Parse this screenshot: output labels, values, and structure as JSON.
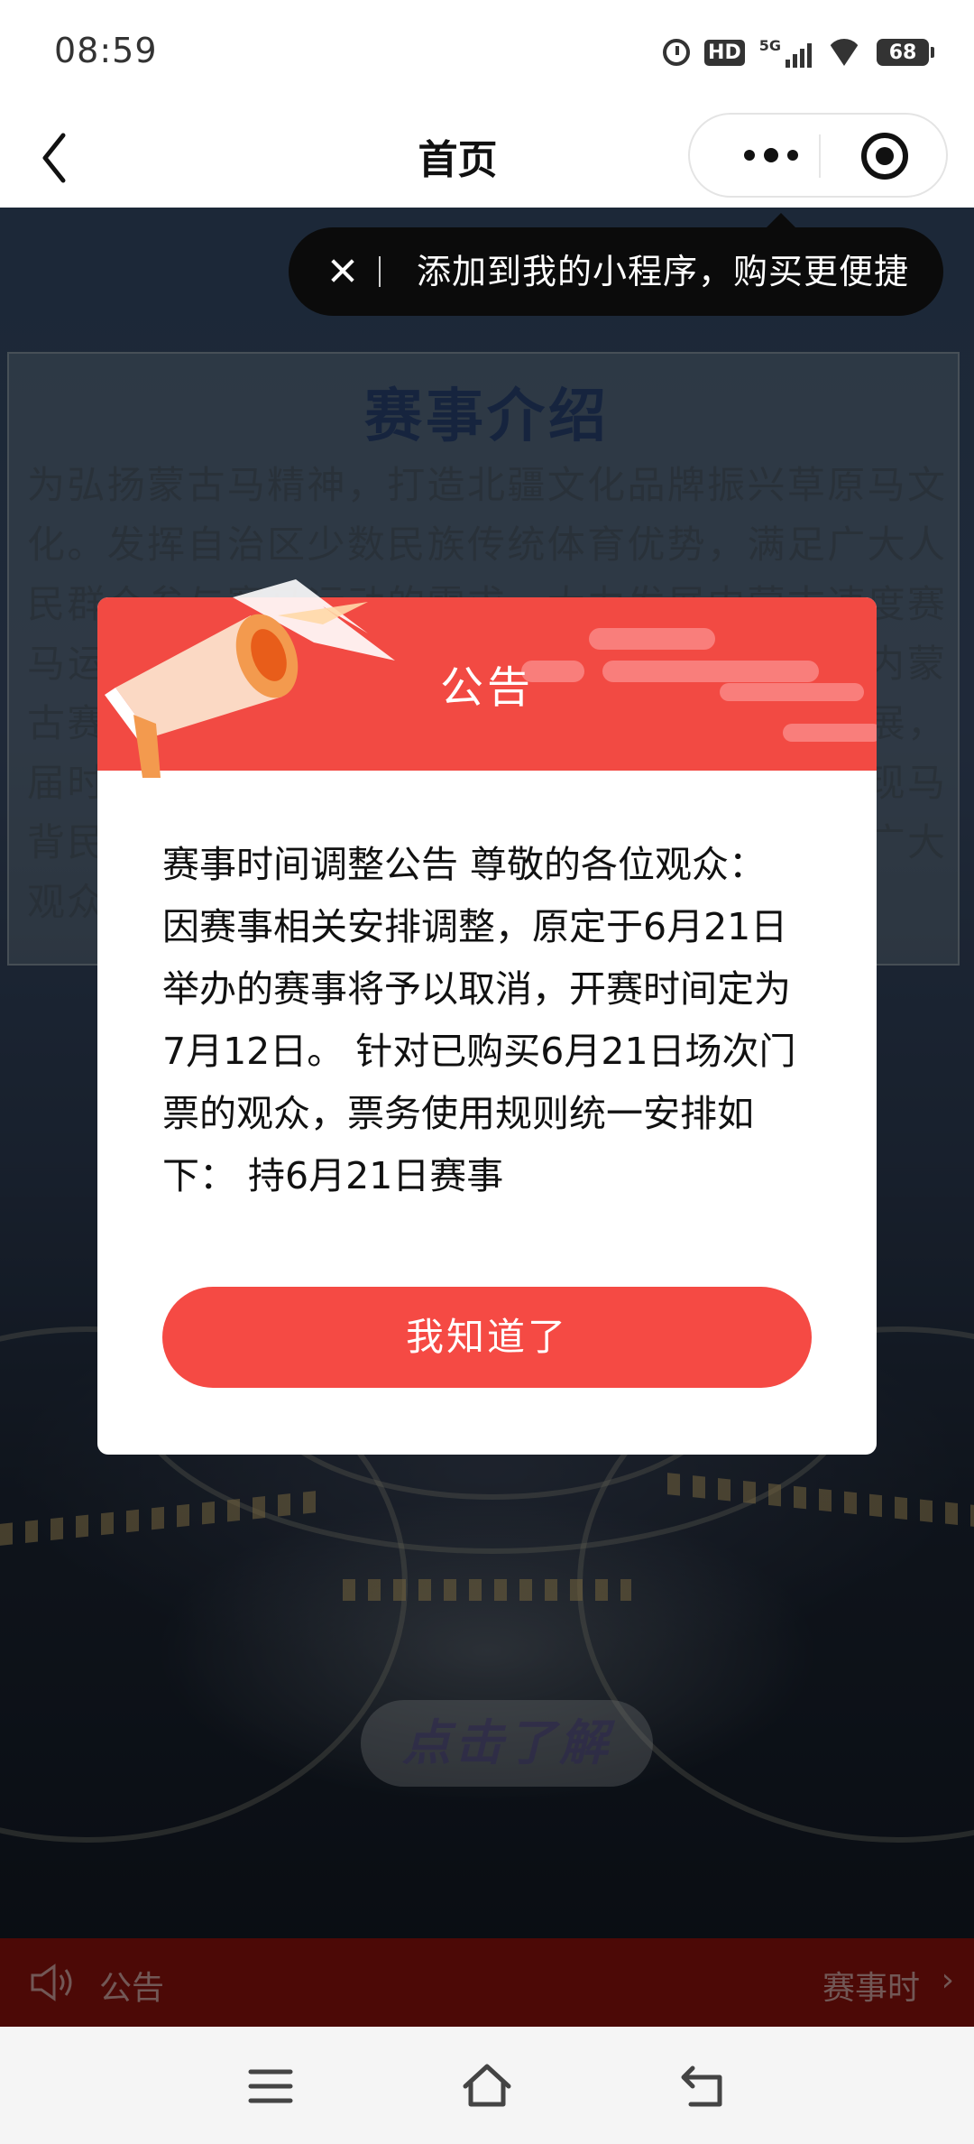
{
  "status_bar": {
    "time": "08:59",
    "hd_label": "HD",
    "network_label": "5G",
    "battery": "68"
  },
  "nav": {
    "title": "首页",
    "back_icon": "chevron-left-icon",
    "more_icon": "more-dots-icon",
    "close_icon": "target-icon"
  },
  "tooltip": {
    "text": "添加到我的小程序，购买更便捷"
  },
  "background": {
    "intro_title": "赛事介绍",
    "intro_text": "为弘扬蒙古马精神，打造北疆文化品牌振兴草原马文化。发挥自治区少数民族传统体育优势，满足广大人民群众参与赛马运动的需求，大力发展内蒙古速度赛马运动项目，特举办本届赛事，于6月中旬，在内蒙古赛马场举行，以进一步推动民族体育运动的发展，届时将有来自全国各地的骑手角逐对决，共同展现马背民族风采。赛事将邀请国家级裁判执裁，欢迎广大观众前来观赛，感受激",
    "learn_button": "点击了解"
  },
  "modal": {
    "title": "公告",
    "body": "赛事时间调整公告 尊敬的各位观众： 因赛事相关安排调整，原定于6月21日举办的赛事将予以取消，开赛时间定为7月12日。 针对已购买6月21日场次门票的观众，票务使用规则统一安排如下： 持6月21日赛事",
    "confirm_button": "我知道了"
  },
  "notice_bar": {
    "label": "公告",
    "scroll_text": "赛事时",
    "arrow": "›"
  },
  "colors": {
    "accent_red": "#f24a43",
    "button_red": "#f54a44",
    "notice_bar_red": "#8a120c"
  }
}
